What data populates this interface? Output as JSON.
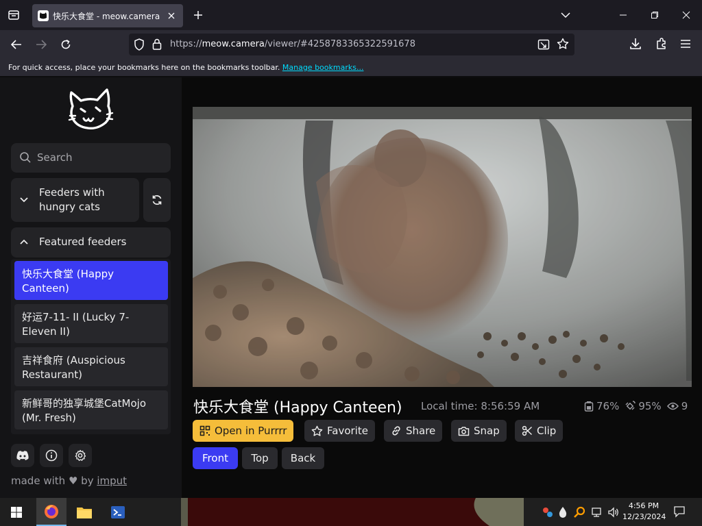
{
  "browser": {
    "tab_title": "快乐大食堂 - meow.camera",
    "url_prefix": "https://",
    "url_host": "meow.camera",
    "url_path": "/viewer/#4258783365322591678",
    "bookmarks_message": "For quick access, place your bookmarks here on the bookmarks toolbar.",
    "bookmarks_link": "Manage bookmarks..."
  },
  "sidebar": {
    "search_placeholder": "Search",
    "feeders_hungry_label": "Feeders with hungry cats",
    "featured_label": "Featured feeders",
    "feeders": [
      {
        "label": "快乐大食堂 (Happy Canteen)",
        "active": true
      },
      {
        "label": "好运7-11- II (Lucky 7-Eleven II)",
        "active": false
      },
      {
        "label": "吉祥食府 (Auspicious Restaurant)",
        "active": false
      },
      {
        "label": "新鲜哥的独享城堡CatMojo (Mr. Fresh)",
        "active": false
      }
    ],
    "footer_icons": [
      "discord-icon",
      "info-icon",
      "settings-icon"
    ],
    "made_with_prefix": "made with",
    "made_with_by": "by",
    "made_with_author": "imput"
  },
  "camera": {
    "title": "快乐大食堂 (Happy Canteen)",
    "local_time": "Local time: 8:56:59 AM",
    "food_level": "76%",
    "signal": "95%",
    "viewers": "9",
    "actions": {
      "open_purrrr": "Open in Purrrr",
      "favorite": "Favorite",
      "share": "Share",
      "snap": "Snap",
      "clip": "Clip"
    },
    "views": {
      "front": "Front",
      "top": "Top",
      "back": "Back",
      "selected": "Front"
    }
  },
  "taskbar": {
    "time": "4:56 PM",
    "date": "12/23/2024"
  },
  "colors": {
    "accent_blue": "#3b3bf2",
    "purrrr_yellow": "#f5bd3a",
    "sidebar_bg": "#141416",
    "button_bg": "#2a2a2e"
  }
}
